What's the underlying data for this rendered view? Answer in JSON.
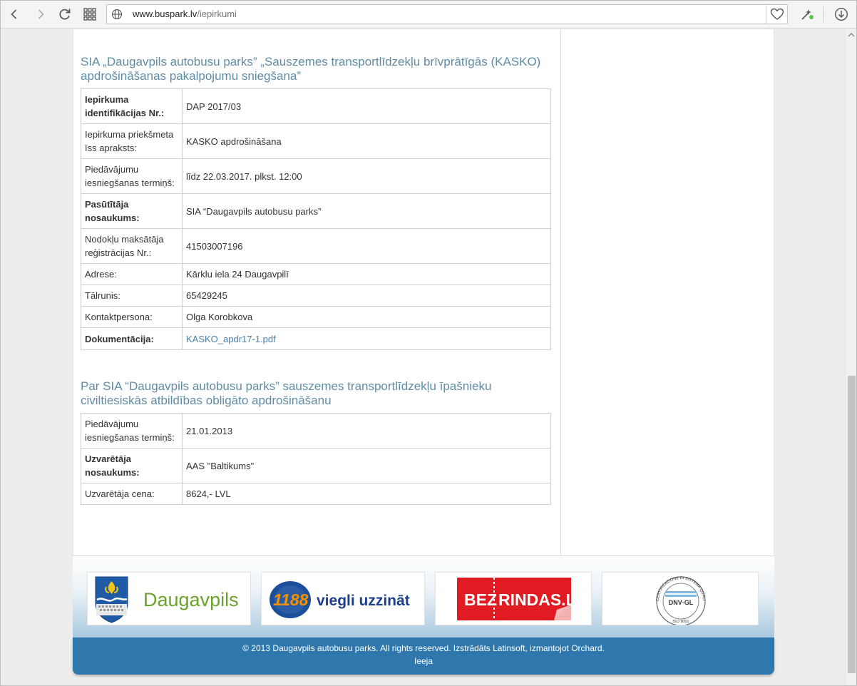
{
  "browser": {
    "url_host": "www.buspark.lv",
    "url_path": "/iepirkumi"
  },
  "section1": {
    "title": "SIA „Daugavpils autobusu parks” „Sauszemes transportlīdzekļu brīvprātīgās (KASKO) apdrošināšanas pakalpojumu sniegšana”",
    "rows": [
      {
        "label": "Iepirkuma identifikācijas Nr.:",
        "value": "DAP 2017/03"
      },
      {
        "label": "Iepirkuma priekšmeta īss apraksts:",
        "value": "KASKO apdrošināšana"
      },
      {
        "label": "Piedāvājumu iesniegšanas termiņš:",
        "value": "līdz 22.03.2017. plkst. 12:00"
      },
      {
        "label": "Pasūtītāja nosaukums:",
        "value": "SIA “Daugavpils autobusu parks”"
      },
      {
        "label": "Nodokļu maksātāja reģistrācijas Nr.:",
        "value": "41503007196"
      },
      {
        "label": "Adrese:",
        "value": "Kārklu iela 24 Daugavpilī"
      },
      {
        "label": "Tālrunis:",
        "value": "65429245"
      },
      {
        "label": "Kontaktpersona:",
        "value": "Olga Korobkova"
      },
      {
        "label": "Dokumentācija:",
        "value": "KASKO_apdr17-1.pdf"
      }
    ]
  },
  "section2": {
    "title": "Par SIA “Daugavpils autobusu parks” sauszemes transportlīdzekļu īpašnieku civiltiesiskās atbildības obligāto apdrošināšanu",
    "rows": [
      {
        "label": "Piedāvājumu iesniegšanas termiņš:",
        "value": "21.01.2013"
      },
      {
        "label": "Uzvarētāja nosaukums:",
        "value": "AAS \"Baltikums\""
      },
      {
        "label": "Uzvarētāja cena:",
        "value": "8624,- LVL"
      }
    ]
  },
  "logos": {
    "daugavpils": "Daugavpils",
    "1188_number": "1188",
    "1188_text": "viegli uzzināt",
    "bezrindas_left": "BEZ",
    "bezrindas_right": "RINDAS.LV",
    "dnv_text": "DNV·GL",
    "dnv_ring": "CERTIFICAZIONE DI SISTEMA QUALITÀ",
    "dnv_iso": "ISO 9001"
  },
  "footer": {
    "copyright": "© 2013 Daugavpils autobusu parks. All rights reserved. Izstrādāts Latinsoft, izmantojot Orchard.",
    "login": "Ieeja"
  },
  "colors": {
    "section_title": "#5f8ca5",
    "link": "#4a7fa6",
    "footer_bar": "#2f78ad"
  }
}
